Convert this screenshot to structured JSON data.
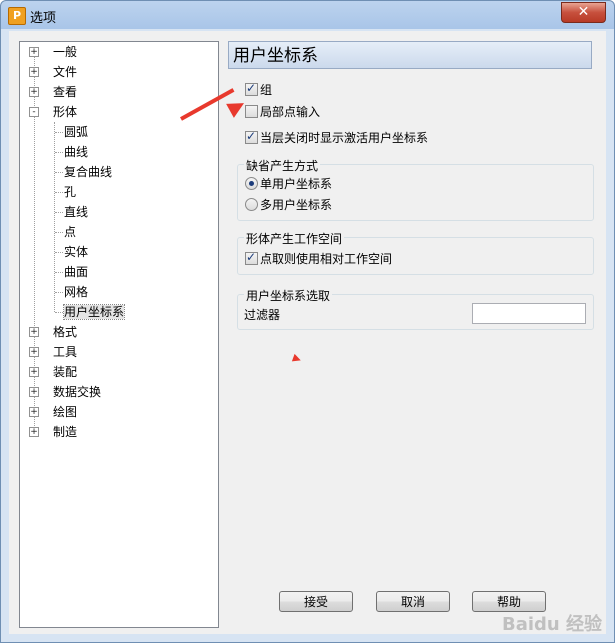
{
  "window": {
    "title": "选项",
    "app_icon_letter": "P",
    "close_glyph": "✕"
  },
  "tree": {
    "items": [
      {
        "label": "一般",
        "expander": "+"
      },
      {
        "label": "文件",
        "expander": "+"
      },
      {
        "label": "查看",
        "expander": "+"
      },
      {
        "label": "形体",
        "expander": "-"
      },
      {
        "label": "圆弧"
      },
      {
        "label": "曲线"
      },
      {
        "label": "复合曲线"
      },
      {
        "label": "孔"
      },
      {
        "label": "直线"
      },
      {
        "label": "点"
      },
      {
        "label": "实体"
      },
      {
        "label": "曲面"
      },
      {
        "label": "网格"
      },
      {
        "label": "用户坐标系"
      },
      {
        "label": "格式",
        "expander": "+"
      },
      {
        "label": "工具",
        "expander": "+"
      },
      {
        "label": "装配",
        "expander": "+"
      },
      {
        "label": "数据交换",
        "expander": "+"
      },
      {
        "label": "绘图",
        "expander": "+"
      },
      {
        "label": "制造",
        "expander": "+"
      }
    ]
  },
  "panel": {
    "title": "用户坐标系",
    "options": {
      "group_label": "组",
      "local_point_input_label": "局部点输入",
      "show_active_ucs_label": "当层关闭时显示激活用户坐标系"
    },
    "default_mode": {
      "title": "缺省产生方式",
      "single_label": "单用户坐标系",
      "multi_label": "多用户坐标系"
    },
    "workspace": {
      "title": "形体产生工作空间",
      "relative_label": "点取则使用相对工作空间"
    },
    "selection": {
      "title": "用户坐标系选取",
      "filter_label": "过滤器",
      "filter_value": ""
    }
  },
  "buttons": {
    "accept": "接受",
    "cancel": "取消",
    "help": "帮助"
  },
  "watermark": "Baidu 经验",
  "colors": {
    "annotation_arrow": "#e8392d",
    "title_bar": "#bcd3ee"
  }
}
